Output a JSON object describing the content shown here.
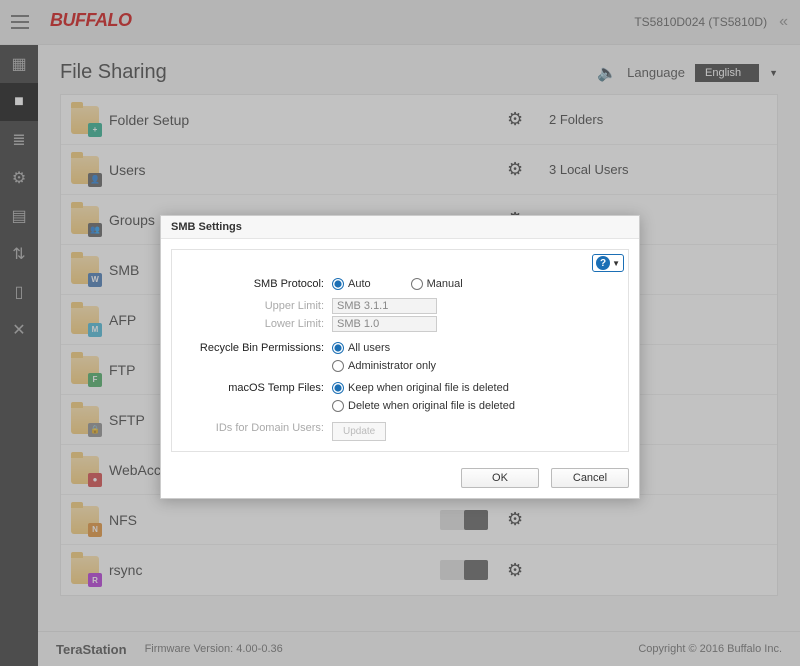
{
  "header": {
    "brand": "BUFFALO",
    "device": "TS5810D024 (TS5810D)",
    "lang_label": "Language",
    "lang_value": "English"
  },
  "page": {
    "title": "File Sharing"
  },
  "rows": [
    {
      "label": "Folder Setup",
      "badge_color": "#2a8",
      "badge_glyph": "+",
      "toggle": null,
      "gear": true,
      "meta": "2 Folders"
    },
    {
      "label": "Users",
      "badge_color": "#555",
      "badge_glyph": "👤",
      "toggle": null,
      "gear": true,
      "meta": "3 Local Users"
    },
    {
      "label": "Groups",
      "badge_color": "#555",
      "badge_glyph": "👥",
      "toggle": null,
      "gear": true,
      "meta": ""
    },
    {
      "label": "SMB",
      "badge_color": "#3a6fb0",
      "badge_glyph": "W",
      "toggle": null,
      "gear": null,
      "meta": ""
    },
    {
      "label": "AFP",
      "badge_color": "#3fb2d4",
      "badge_glyph": "M",
      "toggle": null,
      "gear": null,
      "meta": ""
    },
    {
      "label": "FTP",
      "badge_color": "#3fa65a",
      "badge_glyph": "F",
      "toggle": null,
      "gear": null,
      "meta": ""
    },
    {
      "label": "SFTP",
      "badge_color": "#888",
      "badge_glyph": "🔒",
      "toggle": null,
      "gear": null,
      "meta": ""
    },
    {
      "label": "WebAccess",
      "badge_color": "#d23c3c",
      "badge_glyph": "●",
      "toggle": null,
      "gear": null,
      "meta": ""
    },
    {
      "label": "NFS",
      "badge_color": "#e08a2a",
      "badge_glyph": "N",
      "toggle": "off",
      "gear": true,
      "meta": ""
    },
    {
      "label": "rsync",
      "badge_color": "#b02ad4",
      "badge_glyph": "R",
      "toggle": "off",
      "gear": true,
      "meta": ""
    }
  ],
  "footer": {
    "product": "TeraStation",
    "fw_label": "Firmware Version: 4.00-0.36",
    "copyright": "Copyright © 2016 Buffalo Inc."
  },
  "modal": {
    "title": "SMB Settings",
    "fields": {
      "protocol_label": "SMB Protocol:",
      "proto_auto": "Auto",
      "proto_manual": "Manual",
      "upper_label": "Upper Limit:",
      "upper_value": "SMB 3.1.1",
      "lower_label": "Lower Limit:",
      "lower_value": "SMB 1.0",
      "recycle_label": "Recycle Bin Permissions:",
      "recycle_all": "All users",
      "recycle_admin": "Administrator only",
      "macos_label": "macOS Temp Files:",
      "macos_keep": "Keep when original file is deleted",
      "macos_delete": "Delete when original file is deleted",
      "ids_label": "IDs for Domain Users:",
      "update_btn": "Update"
    },
    "buttons": {
      "ok": "OK",
      "cancel": "Cancel"
    }
  }
}
